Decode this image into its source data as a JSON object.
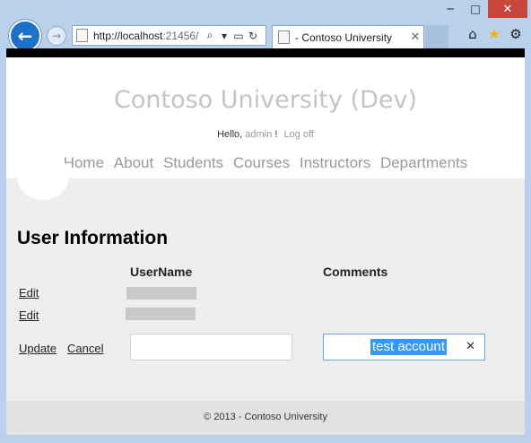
{
  "browser": {
    "url_main": "http://localhost",
    "url_dim": ":21456/",
    "tab_title": "- Contoso University",
    "window_controls": {
      "minimize": "─",
      "maximize": "□",
      "close": "✕"
    },
    "icons": {
      "back": "back-arrow-icon",
      "forward": "forward-arrow-icon",
      "search": "search-icon",
      "refresh": "refresh-icon",
      "home": "home-icon",
      "favorites": "star-icon",
      "settings": "gear-icon"
    }
  },
  "header": {
    "title": "Contoso University (Dev)",
    "greeting": "Hello,",
    "username": "admin",
    "exclaim": "!",
    "logoff": "Log off"
  },
  "menu": [
    "Home",
    "About",
    "Students",
    "Courses",
    "Instructors",
    "Departments"
  ],
  "main": {
    "title": "User Information",
    "columns": {
      "username": "UserName",
      "comments": "Comments"
    },
    "rows": [
      {
        "action": "Edit"
      },
      {
        "action": "Edit"
      }
    ],
    "edit_row": {
      "update": "Update",
      "cancel": "Cancel",
      "username_value": "",
      "comments_value": "test account"
    }
  },
  "footer": {
    "text": "© 2013 - Contoso University"
  },
  "colors": {
    "chrome": "#b9d1ea",
    "back_button": "#1c72c8",
    "selection": "#3399ff",
    "title_gray": "#c4c4c4"
  }
}
